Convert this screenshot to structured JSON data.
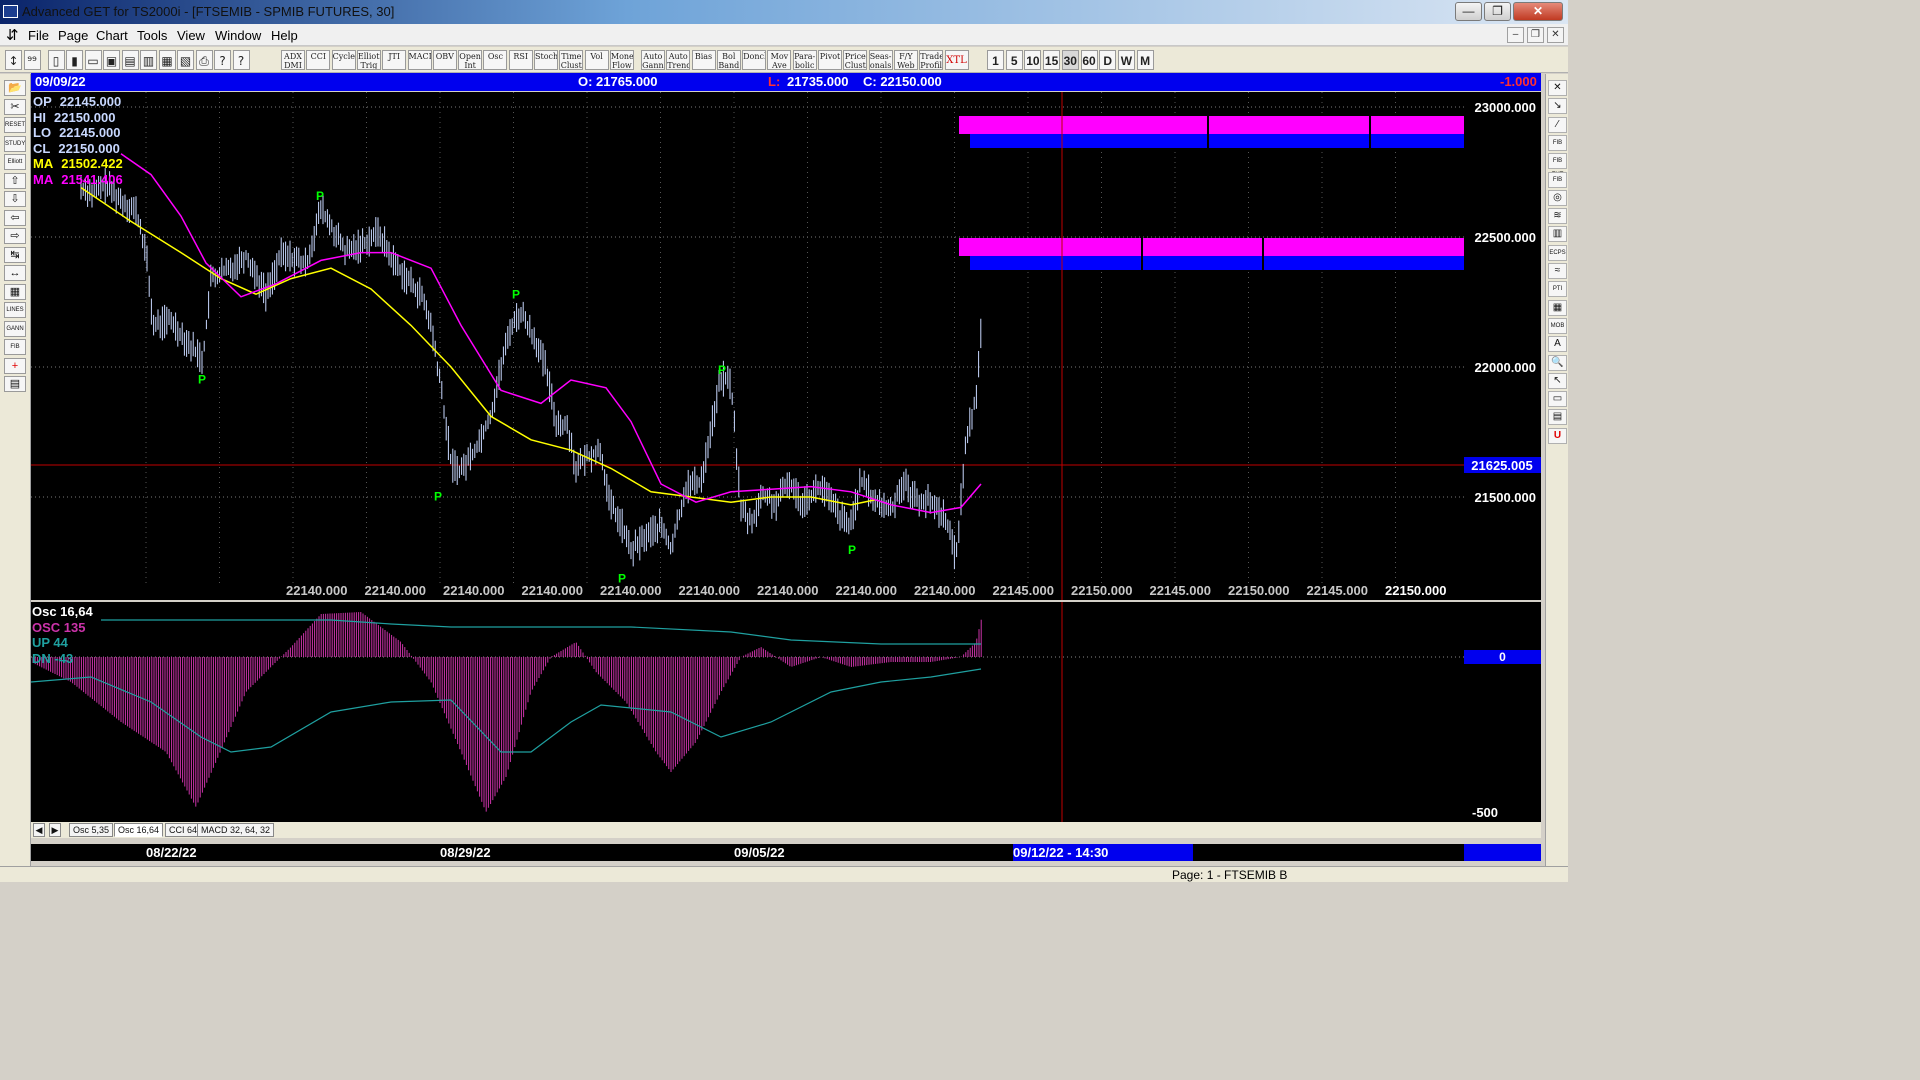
{
  "window": {
    "title": "Advanced GET for TS2000i - [FTSEMIB - SPMIB FUTURES, 30]",
    "minimize": "—",
    "maximize": "❐",
    "close": "✕",
    "mdi_min": "–",
    "mdi_restore": "❐",
    "mdi_close": "✕"
  },
  "menu": [
    "File",
    "Page",
    "Chart",
    "Tools",
    "View",
    "Window",
    "Help"
  ],
  "toolbar": {
    "file_icons": [
      "↕",
      "⁹⁹",
      "▯",
      "▮",
      "▭",
      "▣",
      "▤",
      "▥",
      "▦",
      "▧",
      "⎙",
      "?",
      "?"
    ],
    "studies": [
      "ADX DMI",
      "CCI",
      "Cycles",
      "Elliott Trig",
      "JTI",
      "MACD",
      "OBV",
      "Open Int",
      "Osc",
      "RSI",
      "Stoch",
      "Time Clust",
      "Vol",
      "Money Flow",
      "Auto Gann",
      "Auto Trend",
      "Bias",
      "Bol Band",
      "Donch",
      "Mov Ave",
      "Para-bolic",
      "Pivot",
      "Price Clust",
      "Seas-onals",
      "F/Y Web",
      "Trade Profile",
      "XTL"
    ],
    "periods": [
      "1",
      "5",
      "10",
      "15",
      "30",
      "60",
      "D",
      "W",
      "M"
    ],
    "active_period": "30"
  },
  "left_tools": [
    "📂",
    "✂",
    "RESET",
    "STUDY",
    "Elliott",
    "⇧",
    "⇩",
    "⇦",
    "⇨",
    "↹",
    "↔",
    "▦",
    "LINES",
    "GANN",
    "FIB",
    "+",
    "▤"
  ],
  "right_tools": [
    "✕",
    "↘",
    "⁄",
    "FIB RET",
    "FIB EXT",
    "FIB TIME",
    "◎",
    "≋",
    "▥",
    "ECPS",
    "≈",
    "PTI",
    "▦",
    "MOB",
    "A",
    "🔍",
    "↖",
    "▭",
    "▤",
    "U"
  ],
  "infobar": {
    "date": "09/09/22",
    "open": "O: 21765.000",
    "low_label": "L:",
    "low": "21735.000",
    "close": "C: 22150.000",
    "change": "-1.000"
  },
  "ohlc_legend": [
    {
      "label": "OP",
      "value": "22145.000",
      "color": "#c8d8ff"
    },
    {
      "label": "HI",
      "value": "22150.000",
      "color": "#c8d8ff"
    },
    {
      "label": "LO",
      "value": "22145.000",
      "color": "#c8d8ff"
    },
    {
      "label": "CL",
      "value": "22150.000",
      "color": "#c8d8ff"
    },
    {
      "label": "MA",
      "value": "21502.422",
      "color": "#ffff00"
    },
    {
      "label": "MA",
      "value": "21541.406",
      "color": "#ff00ff"
    }
  ],
  "price_axis": {
    "labels": [
      "23000.000",
      "22500.000",
      "22000.000",
      "21500.000"
    ],
    "cursor_price": "21625.005"
  },
  "bottom_price_labels": [
    "22140.000",
    "22140.000",
    "22140.000",
    "22140.000",
    "22140.000",
    "22140.000",
    "22140.000",
    "22140.000",
    "22140.000",
    "22145.000",
    "22150.000",
    "22145.000",
    "22150.000",
    "22145.000",
    "22150.000"
  ],
  "pivot_label": "P",
  "osc_legend": {
    "title": "Osc 16,64",
    "osc": "OSC 135",
    "up": "UP   44",
    "dn": "DN   -43"
  },
  "osc_axis": {
    "zero": "0",
    "low": "-500"
  },
  "tabs": [
    "Osc 5,35",
    "Osc 16,64",
    "CCI 64",
    "MACD 32, 64, 32"
  ],
  "active_tab": "Osc 16,64",
  "dates": [
    "08/22/22",
    "08/29/22",
    "09/05/22",
    "09/12/22 - 14:30"
  ],
  "status": "Page: 1 - FTSEMIB B",
  "colors": {
    "bars": "#c8d8ff",
    "ma_fast": "#ffff00",
    "ma_slow": "#ff00ff",
    "pivot": "#00ff00",
    "zone_magenta": "#ff00ff",
    "zone_blue": "#0000ff",
    "osc_hist": "#cc33aa",
    "osc_bands": "#1fa0a0"
  }
}
